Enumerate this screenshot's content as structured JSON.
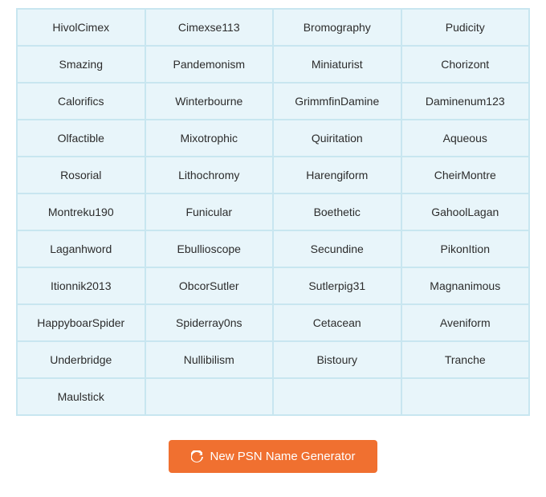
{
  "grid": {
    "cells": [
      "HivolCimex",
      "Cimexse113",
      "Bromography",
      "Pudicity",
      "Smazing",
      "Pandemonism",
      "Miniaturist",
      "Chorizont",
      "Calorifics",
      "Winterbourne",
      "GrimmfinDamine",
      "Daminenum123",
      "Olfactible",
      "Mixotrophic",
      "Quiritation",
      "Aqueous",
      "Rosorial",
      "Lithochromy",
      "Harengiform",
      "CheirMontre",
      "Montreku190",
      "Funicular",
      "Boethetic",
      "GahoolLagan",
      "Laganhword",
      "Ebullioscope",
      "Secundine",
      "PikonItion",
      "Itionnik2013",
      "ObcorSutler",
      "Sutlerpig31",
      "Magnanimous",
      "HappyboarSpider",
      "Spiderray0ns",
      "Cetacean",
      "Aveniform",
      "Underbridge",
      "Nullibilism",
      "Bistoury",
      "Tranche",
      "Maulstick",
      "",
      "",
      ""
    ]
  },
  "button": {
    "label": "New PSN Name Generator",
    "icon": "refresh"
  }
}
